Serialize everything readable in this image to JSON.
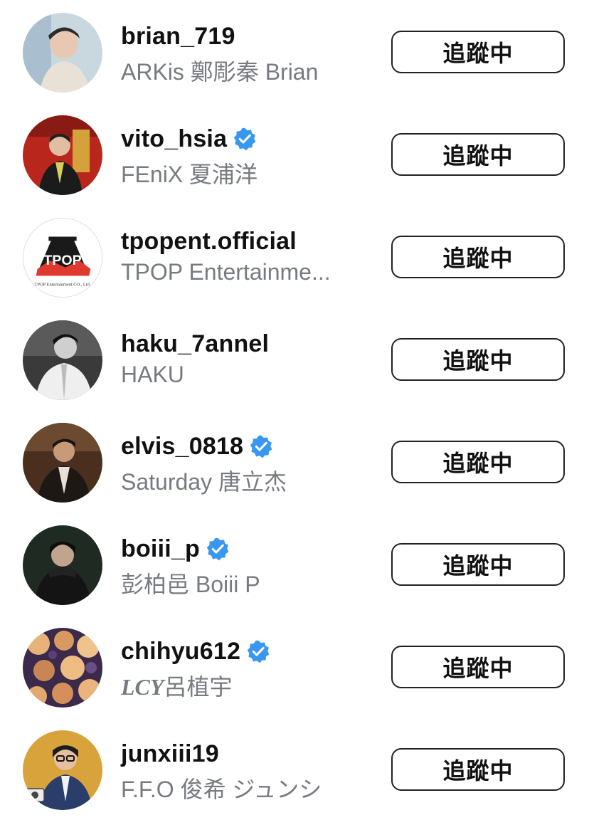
{
  "accent_verified": "#3897f0",
  "following_label": "追蹤中",
  "accounts": [
    {
      "username": "brian_719",
      "verified": false,
      "full_name": "ARKis 鄭彫秦 Brian",
      "avatar_icon": "profile-photo"
    },
    {
      "username": "vito_hsia",
      "verified": true,
      "full_name": "FEniX 夏浦洋",
      "avatar_icon": "profile-photo"
    },
    {
      "username": "tpopent.official",
      "verified": false,
      "full_name": "TPOP Entertainme...",
      "avatar_icon": "tpop-logo",
      "avatar_logo_text": "TPOP",
      "avatar_logo_subtext": "TPOP Entertainment CO., Ltd."
    },
    {
      "username": "haku_7annel",
      "verified": false,
      "full_name": "HAKU",
      "avatar_icon": "profile-photo"
    },
    {
      "username": "elvis_0818",
      "verified": true,
      "full_name": "Saturday 唐立杰",
      "avatar_icon": "profile-photo"
    },
    {
      "username": "boiii_p",
      "verified": true,
      "full_name": "彭柏邑 Boiii P",
      "avatar_icon": "profile-photo"
    },
    {
      "username": "chihyu612",
      "verified": true,
      "full_name_mark": "LCY",
      "full_name": "呂植宇",
      "avatar_icon": "flowers-photo"
    },
    {
      "username": "junxiii19",
      "verified": false,
      "full_name": "F.F.O 俊希 ジュンシ",
      "avatar_icon": "profile-photo"
    }
  ]
}
